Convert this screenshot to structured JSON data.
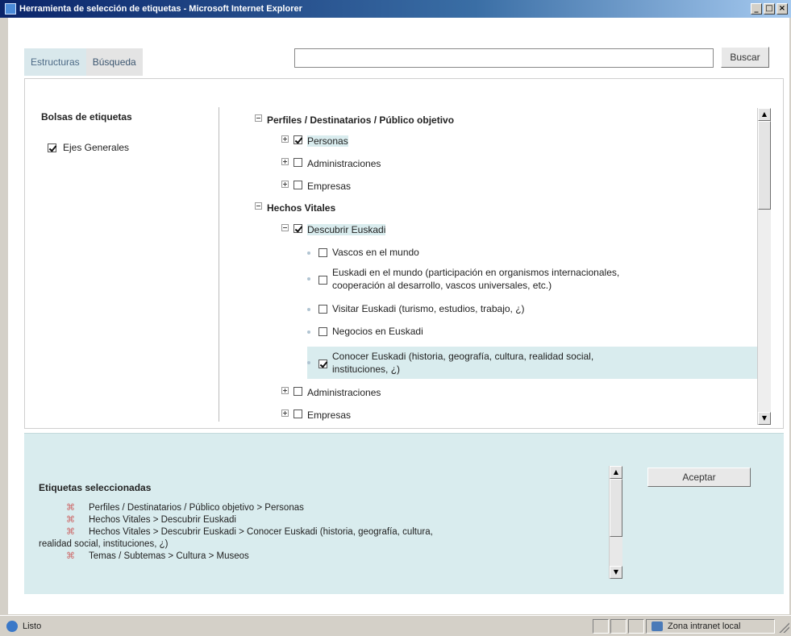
{
  "window": {
    "title": "Herramienta de selección de etiquetas - Microsoft Internet Explorer",
    "controls": [
      "_",
      "□",
      "×"
    ]
  },
  "tabs": [
    {
      "label": "Estructuras",
      "active": true
    },
    {
      "label": "Búsqueda",
      "active": false
    }
  ],
  "search": {
    "value": "",
    "button": "Buscar"
  },
  "left": {
    "heading": "Bolsas de etiquetas",
    "items": [
      {
        "label": "Ejes Generales",
        "checked": true
      }
    ]
  },
  "tree": {
    "g1": {
      "label": "Perfiles / Destinatarios / Público objetivo"
    },
    "g1_items": [
      {
        "label": "Personas",
        "checked": true,
        "highlight": true
      },
      {
        "label": "Administraciones",
        "checked": false
      },
      {
        "label": "Empresas",
        "checked": false
      }
    ],
    "g2": {
      "label": "Hechos Vitales"
    },
    "g2_item": {
      "label": "Descubrir Euskadi",
      "checked": true
    },
    "g2_children": [
      {
        "line1": "Vascos en el mundo",
        "line2": "",
        "checked": false
      },
      {
        "line1": "Euskadi en el mundo (participación en organismos internacionales,",
        "line2": "cooperación al desarrollo, vascos universales, etc.)",
        "checked": false
      },
      {
        "line1": "Visitar Euskadi (turismo, estudios, trabajo, ¿)",
        "line2": "",
        "checked": false
      },
      {
        "line1": "Negocios en Euskadi",
        "line2": "",
        "checked": false
      },
      {
        "line1": "Conocer Euskadi (historia, geografía, cultura, realidad social,",
        "line2": "instituciones, ¿)",
        "checked": true
      }
    ],
    "g2_more": [
      {
        "label": "Administraciones",
        "checked": false
      },
      {
        "label": "Empresas",
        "checked": false
      }
    ]
  },
  "selected": {
    "heading": "Etiquetas seleccionadas",
    "remove_symbol": "⌘",
    "items": [
      "Perfiles / Destinatarios / Público objetivo > Personas",
      "Hechos Vitales > Descubrir Euskadi",
      "Hechos Vitales > Descubrir Euskadi > Conocer Euskadi (historia, geografía, cultura,",
      "Temas / Subtemas > Cultura > Museos"
    ],
    "wrap_continuation": "realidad social, instituciones, ¿)",
    "accept": "Aceptar"
  },
  "statusbar": {
    "left": "Listo",
    "zone": "Zona intranet local"
  },
  "colors": {
    "highlight": "#d9ecee",
    "tab_active": "#d9e8ec",
    "titlebar": "#0a246a"
  }
}
